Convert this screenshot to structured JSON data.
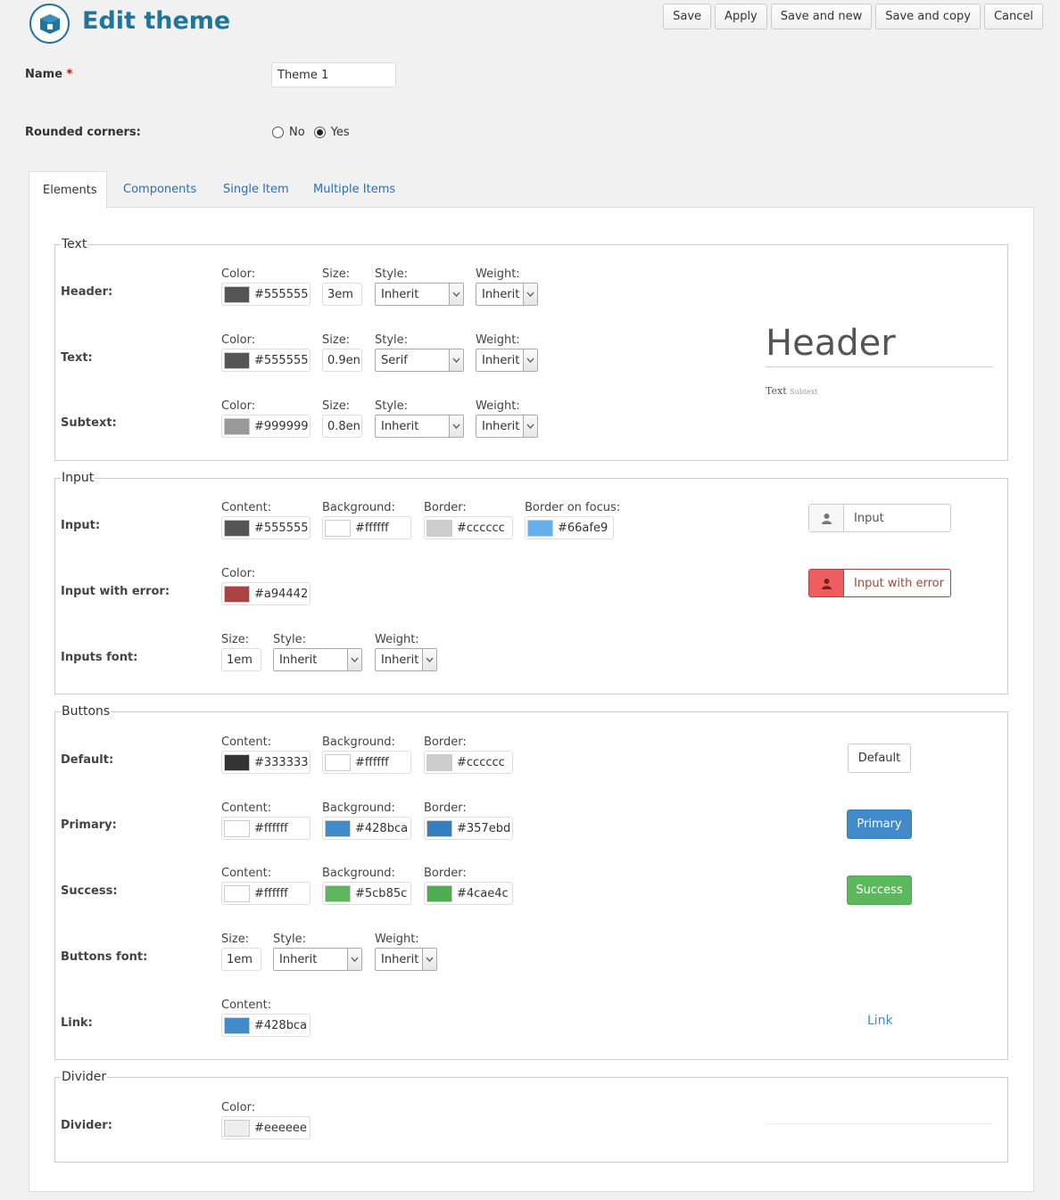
{
  "header": {
    "title": "Edit theme",
    "toolbar": [
      "Save",
      "Apply",
      "Save and new",
      "Save and copy",
      "Cancel"
    ]
  },
  "form": {
    "name_label": "Name",
    "name_required": "*",
    "name_value": "Theme 1",
    "rounded_label": "Rounded corners:",
    "rounded_no": "No",
    "rounded_yes": "Yes",
    "rounded_selected": "Yes"
  },
  "tabs": [
    "Elements",
    "Components",
    "Single Item",
    "Multiple Items"
  ],
  "text_section": {
    "legend": "Text",
    "labels": {
      "color": "Color:",
      "size": "Size:",
      "style": "Style:",
      "weight": "Weight:"
    },
    "rows": [
      {
        "label": "Header:",
        "color": "#555555",
        "size": "3em",
        "style": "Inherit",
        "weight": "Inherit"
      },
      {
        "label": "Text:",
        "color": "#555555",
        "size": "0.9en",
        "style": "Serif",
        "weight": "Inherit"
      },
      {
        "label": "Subtext:",
        "color": "#999999",
        "size": "0.8en",
        "style": "Inherit",
        "weight": "Inherit"
      }
    ],
    "preview_header": "Header",
    "preview_text": "Text",
    "preview_subtext": "Subtext"
  },
  "input_section": {
    "legend": "Input",
    "input_row": {
      "label": "Input:",
      "content_label": "Content:",
      "content": "#555555",
      "background_label": "Background:",
      "background": "#ffffff",
      "border_label": "Border:",
      "border": "#cccccc",
      "focus_label": "Border on focus:",
      "focus": "#66afe9"
    },
    "error_row": {
      "label": "Input with error:",
      "color_label": "Color:",
      "color": "#a94442"
    },
    "font_row": {
      "label": "Inputs font:",
      "size_label": "Size:",
      "size": "1em",
      "style_label": "Style:",
      "style": "Inherit",
      "weight_label": "Weight:",
      "weight": "Inherit"
    },
    "preview_input": "Input",
    "preview_error": "Input with error"
  },
  "buttons_section": {
    "legend": "Buttons",
    "labels": {
      "content": "Content:",
      "background": "Background:",
      "border": "Border:"
    },
    "rows": [
      {
        "label": "Default:",
        "content": "#333333",
        "background": "#ffffff",
        "border": "#cccccc",
        "preview": "Default"
      },
      {
        "label": "Primary:",
        "content": "#ffffff",
        "background": "#428bca",
        "border": "#357ebd",
        "preview": "Primary"
      },
      {
        "label": "Success:",
        "content": "#ffffff",
        "background": "#5cb85c",
        "border": "#4cae4c",
        "preview": "Success"
      }
    ],
    "font_row": {
      "label": "Buttons font:",
      "size_label": "Size:",
      "size": "1em",
      "style_label": "Style:",
      "style": "Inherit",
      "weight_label": "Weight:",
      "weight": "Inherit"
    },
    "link_row": {
      "label": "Link:",
      "content_label": "Content:",
      "content": "#428bca",
      "preview": "Link"
    }
  },
  "divider_section": {
    "legend": "Divider",
    "label": "Divider:",
    "color_label": "Color:",
    "color": "#eeeeee"
  },
  "colors": {
    "accent": "#21759b",
    "link": "#2a6fb6"
  },
  "icons": {
    "logo": "box-icon",
    "user": "user-icon",
    "arrow": "chevron-down-icon"
  }
}
